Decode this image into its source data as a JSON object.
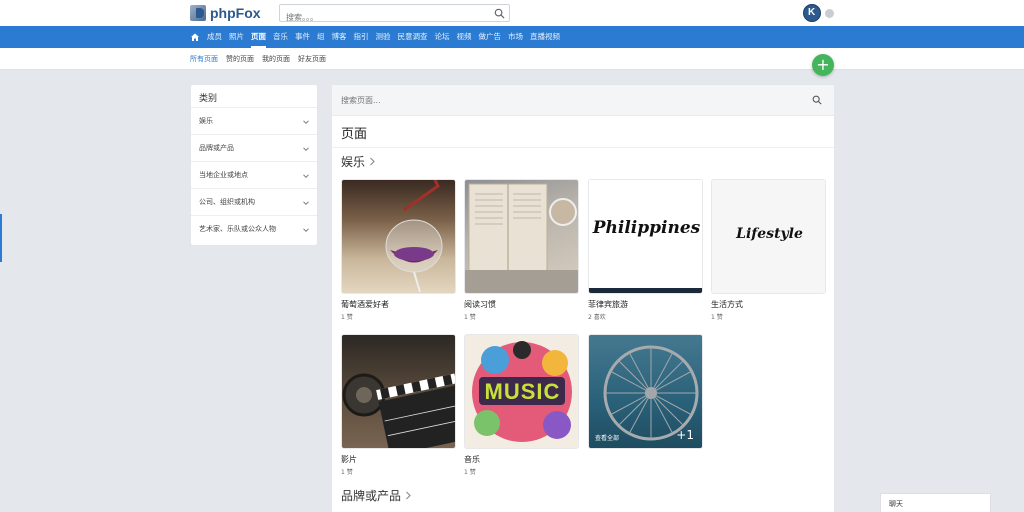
{
  "header": {
    "logo_text": "phpFox",
    "search_placeholder": "搜索。。。"
  },
  "nav": {
    "items": [
      "成员",
      "照片",
      "页面",
      "音乐",
      "事件",
      "组",
      "博客",
      "指引",
      "测验",
      "民意调查",
      "论坛",
      "视频",
      "做广告",
      "市场",
      "直播视频"
    ],
    "active_index": 2
  },
  "subnav": {
    "items": [
      "所有页面",
      "赞的页面",
      "我的页面",
      "好友页面"
    ],
    "active_index": 0
  },
  "fab_label": "+",
  "categories": {
    "title": "类别",
    "items": [
      "娱乐",
      "品牌或产品",
      "当地企业或地点",
      "公司、组织或机构",
      "艺术家、乐队或公众人物"
    ]
  },
  "main": {
    "search_placeholder": "搜索页面...",
    "heading": "页面",
    "sections": [
      {
        "title": "娱乐",
        "cards": [
          {
            "name": "葡萄酒爱好者",
            "meta": "1 赞"
          },
          {
            "name": "阅读习惯",
            "meta": "1 赞"
          },
          {
            "name": "菲律宾旅游",
            "meta": "2 喜欢",
            "overlay_text": "Philippines"
          },
          {
            "name": "生活方式",
            "meta": "1 赞",
            "overlay_text": "Lifestyle"
          },
          {
            "name": "影片",
            "meta": "1 赞"
          },
          {
            "name": "音乐",
            "meta": "1 赞",
            "overlay_text": "MUSIC"
          },
          {
            "view_all": "查看全部",
            "more_count": "+1"
          }
        ]
      },
      {
        "title": "品牌或产品"
      }
    ]
  },
  "chat": {
    "label": "聊天"
  },
  "colors": {
    "nav_blue": "#2a7bd1",
    "fab_green": "#44b55b",
    "bg": "#e4e7ec"
  }
}
